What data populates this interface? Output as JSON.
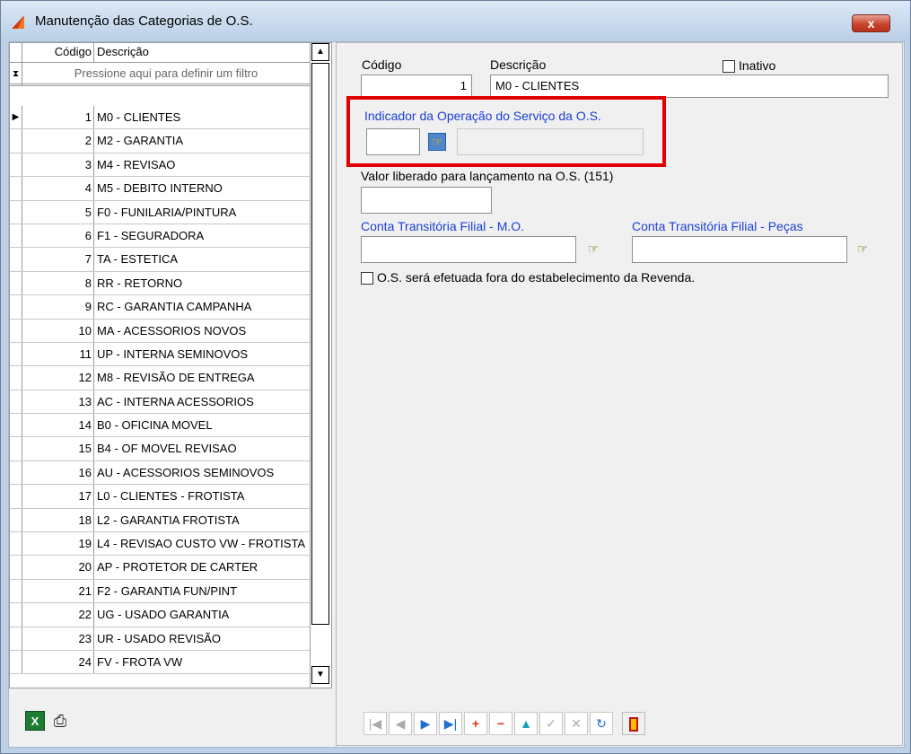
{
  "window": {
    "title": "Manutenção das Categorias de O.S.",
    "close_label": "x"
  },
  "grid": {
    "headers": {
      "codigo": "Código",
      "descricao": "Descrição"
    },
    "filter_text": "Pressione aqui para definir um filtro",
    "rows": [
      {
        "code": "1",
        "desc": "M0 - CLIENTES"
      },
      {
        "code": "2",
        "desc": "M2 - GARANTIA"
      },
      {
        "code": "3",
        "desc": "M4 - REVISAO"
      },
      {
        "code": "4",
        "desc": "M5 - DEBITO INTERNO"
      },
      {
        "code": "5",
        "desc": "F0 - FUNILARIA/PINTURA"
      },
      {
        "code": "6",
        "desc": "F1 - SEGURADORA"
      },
      {
        "code": "7",
        "desc": "TA - ESTETICA"
      },
      {
        "code": "8",
        "desc": "RR - RETORNO"
      },
      {
        "code": "9",
        "desc": "RC - GARANTIA CAMPANHA"
      },
      {
        "code": "10",
        "desc": "MA - ACESSORIOS NOVOS"
      },
      {
        "code": "11",
        "desc": "UP - INTERNA SEMINOVOS"
      },
      {
        "code": "12",
        "desc": "M8 - REVISÃO DE ENTREGA"
      },
      {
        "code": "13",
        "desc": "AC - INTERNA ACESSORIOS"
      },
      {
        "code": "14",
        "desc": "B0 - OFICINA MOVEL"
      },
      {
        "code": "15",
        "desc": "B4 - OF MOVEL REVISAO"
      },
      {
        "code": "16",
        "desc": "AU - ACESSORIOS SEMINOVOS"
      },
      {
        "code": "17",
        "desc": "L0 - CLIENTES - FROTISTA"
      },
      {
        "code": "18",
        "desc": "L2 - GARANTIA FROTISTA"
      },
      {
        "code": "19",
        "desc": "L4 -  REVISAO CUSTO VW - FROTISTA"
      },
      {
        "code": "20",
        "desc": "AP - PROTETOR DE CARTER"
      },
      {
        "code": "21",
        "desc": "F2 - GARANTIA FUN/PINT"
      },
      {
        "code": "22",
        "desc": "UG - USADO GARANTIA"
      },
      {
        "code": "23",
        "desc": "UR - USADO REVISÃO"
      },
      {
        "code": "24",
        "desc": "FV - FROTA VW"
      }
    ]
  },
  "form": {
    "codigo_label": "Código",
    "codigo_value": "1",
    "descricao_label": "Descrição",
    "descricao_value": "M0 - CLIENTES",
    "inativo_label": "Inativo",
    "indicador_label": "Indicador da Operação do Serviço  da O.S.",
    "indicador_value": "",
    "indicador_desc": "",
    "valor_label": "Valor liberado para lançamento na O.S. (151)",
    "valor_value": "",
    "conta_mo_label": "Conta Transitória Filial - M.O.",
    "conta_mo_value": "",
    "conta_pecas_label": "Conta Transitória Filial - Peças",
    "conta_pecas_value": "",
    "fora_label": "O.S. será efetuada fora do estabelecimento da Revenda."
  },
  "icons": {
    "lookup": "pointing-hand-icon",
    "excel": "excel-icon",
    "print": "print-icon",
    "exit": "exit-door-icon"
  },
  "colors": {
    "highlight": "#e00000",
    "link_label": "#1a3fd6"
  }
}
